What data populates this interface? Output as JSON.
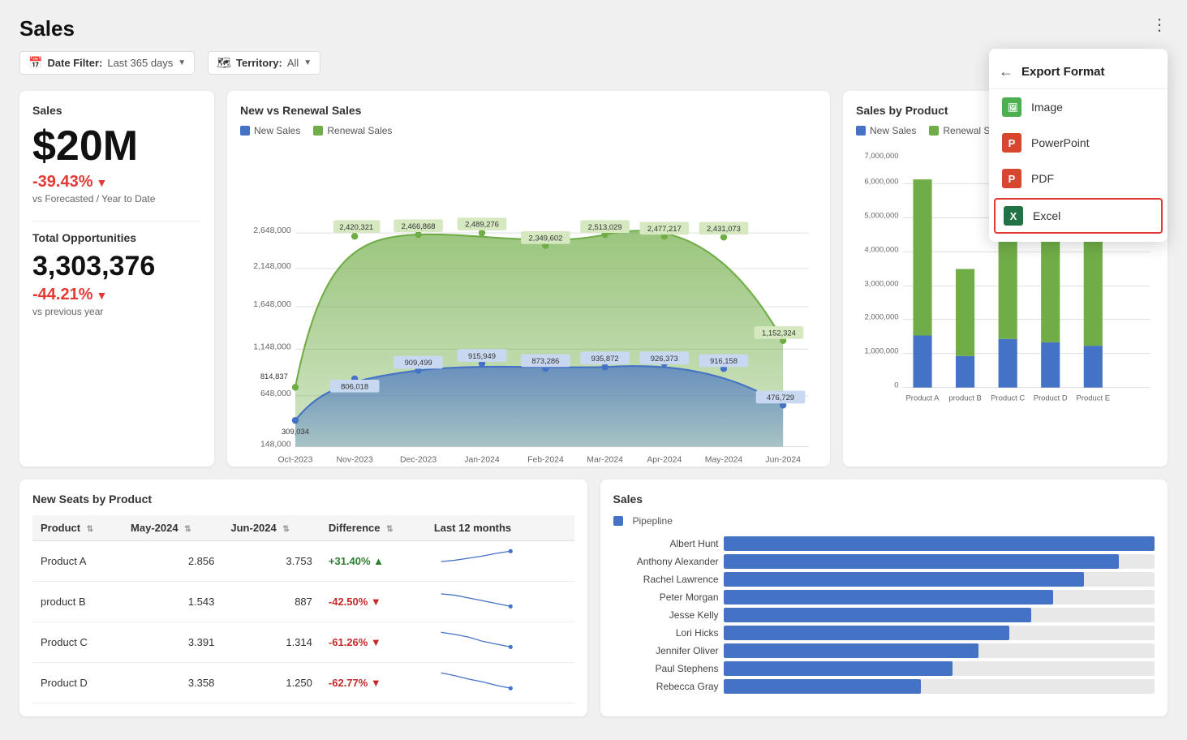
{
  "page": {
    "title": "Sales",
    "more_icon": "⋮"
  },
  "filters": {
    "date_filter_label": "Date Filter:",
    "date_filter_value": "Last 365 days",
    "territory_label": "Territory:",
    "territory_value": "All"
  },
  "sales_kpi": {
    "label": "Sales",
    "value": "$20M",
    "change": "-39.43%",
    "vs": "vs Forecasted / Year to Date"
  },
  "opportunities_kpi": {
    "label": "Total Opportunities",
    "value": "3,303,376",
    "change": "-44.21%",
    "vs": "vs previous year"
  },
  "new_vs_renewal": {
    "title": "New vs Renewal Sales",
    "legend_new": "New Sales",
    "legend_renewal": "Renewal Sales",
    "data_points": [
      {
        "month": "Oct-2023",
        "new": 309034,
        "renewal": 814837
      },
      {
        "month": "Nov-2023",
        "new": 806018,
        "renewal": 2420321
      },
      {
        "month": "Dec-2023",
        "new": 909499,
        "renewal": 2466868
      },
      {
        "month": "Jan-2024",
        "new": 915949,
        "renewal": 2489276
      },
      {
        "month": "Feb-2024",
        "new": 873286,
        "renewal": 2349602
      },
      {
        "month": "Mar-2024",
        "new": 935872,
        "renewal": 2513029
      },
      {
        "month": "Apr-2024",
        "new": 926373,
        "renewal": 2477217
      },
      {
        "month": "May-2024",
        "new": 916158,
        "renewal": 2431073
      },
      {
        "month": "Jun-2024",
        "new": 476729,
        "renewal": 1152324
      }
    ]
  },
  "sales_by_product": {
    "title": "Sales by Product",
    "legend_new": "New Sales",
    "legend_renewal": "Renewal Sales",
    "products": [
      "Product A",
      "product B",
      "Product C",
      "Product D",
      "Product E"
    ],
    "new_sales": [
      1500000,
      900000,
      1400000,
      1300000,
      1200000
    ],
    "renewal_sales": [
      4500000,
      2500000,
      3700000,
      4000000,
      3600000
    ],
    "y_labels": [
      "0",
      "1,000,000",
      "2,000,000",
      "3,000,000",
      "4,000,000",
      "5,000,000",
      "6,000,000",
      "7,000,000"
    ]
  },
  "new_seats": {
    "title": "New Seats by Product",
    "columns": [
      "Product",
      "May-2024",
      "Jun-2024",
      "Difference",
      "Last 12 months"
    ],
    "rows": [
      {
        "product": "Product A",
        "may": "2.856",
        "jun": "3.753",
        "diff": "+31.40%",
        "diff_type": "positive"
      },
      {
        "product": "product B",
        "may": "1.543",
        "jun": "887",
        "diff": "-42.50%",
        "diff_type": "negative"
      },
      {
        "product": "Product C",
        "may": "3.391",
        "jun": "1.314",
        "diff": "-61.26%",
        "diff_type": "negative"
      },
      {
        "product": "Product D",
        "may": "3.358",
        "jun": "1.250",
        "diff": "-62.77%",
        "diff_type": "negative"
      }
    ]
  },
  "sales_pipeline": {
    "title": "Sales",
    "legend_label": "Pipepline",
    "people": [
      {
        "name": "Albert Hunt",
        "value": 98
      },
      {
        "name": "Anthony Alexander",
        "value": 90
      },
      {
        "name": "Rachel Lawrence",
        "value": 82
      },
      {
        "name": "Peter Morgan",
        "value": 75
      },
      {
        "name": "Jesse Kelly",
        "value": 70
      },
      {
        "name": "Lori Hicks",
        "value": 65
      },
      {
        "name": "Jennifer Oliver",
        "value": 58
      },
      {
        "name": "Paul Stephens",
        "value": 52
      },
      {
        "name": "Rebecca Gray",
        "value": 45
      }
    ]
  },
  "export_dropdown": {
    "title": "Export Format",
    "items": [
      {
        "label": "Image",
        "icon_type": "image",
        "icon_text": "🖼"
      },
      {
        "label": "PowerPoint",
        "icon_type": "ppt",
        "icon_text": "P"
      },
      {
        "label": "PDF",
        "icon_type": "pdf",
        "icon_text": "P"
      },
      {
        "label": "Excel",
        "icon_type": "excel",
        "icon_text": "X"
      }
    ]
  }
}
